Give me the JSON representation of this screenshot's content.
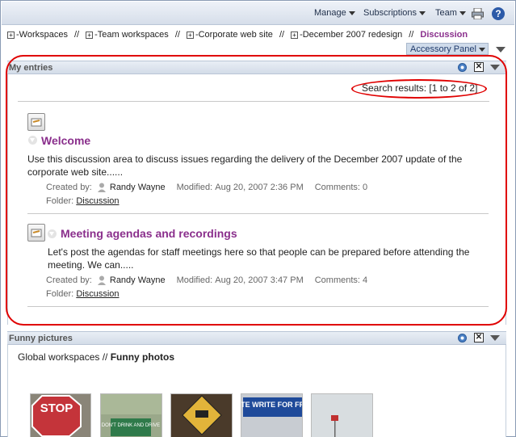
{
  "menus": [
    {
      "label": "Manage"
    },
    {
      "label": "Subscriptions"
    },
    {
      "label": "Team"
    }
  ],
  "icons": {
    "printer": "printer-icon",
    "help": "help-icon",
    "gear": "gear-icon",
    "close": "close-icon",
    "collapse": "collapse-triangle-icon",
    "expand": "plus-box-icon",
    "entry": "discussion-entry-icon",
    "person": "person-icon"
  },
  "help_glyph": "?",
  "breadcrumb": {
    "items": [
      "-Workspaces",
      "-Team workspaces",
      "-Corporate web site",
      "-December 2007 redesign"
    ],
    "separator": "//",
    "current": "Discussion",
    "plus": "+"
  },
  "accessory_panel": {
    "label": "Accessory Panel"
  },
  "my_entries": {
    "title": "My entries",
    "search_results": "Search results: [1 to 2 of 2]",
    "entries": [
      {
        "title": "Welcome",
        "description_lines": [
          "Use this discussion area to discuss issues regarding the delivery of the December 2007 update of the",
          "corporate web site......"
        ],
        "created_by_label": "Created by:",
        "author": "Randy Wayne",
        "modified_label": "Modified:",
        "modified": "Aug 20, 2007 2:36 PM",
        "comments_label": "Comments:",
        "comments": "0",
        "folder_label": "Folder:",
        "folder": "Discussion"
      },
      {
        "title": "Meeting agendas and recordings",
        "description_lines": [
          "Let's post the agendas for staff meetings here so that people can be prepared before attending the",
          "meeting. We can....."
        ],
        "created_by_label": "Created by:",
        "author": "Randy Wayne",
        "modified_label": "Modified:",
        "modified": "Aug 20, 2007 3:47 PM",
        "comments_label": "Comments:",
        "comments": "4",
        "folder_label": "Folder:",
        "folder": "Discussion"
      }
    ]
  },
  "funny_pictures": {
    "title": "Funny pictures",
    "path_prefix": "Global workspaces // ",
    "path_current": "Funny photos",
    "thumbnails": [
      {
        "name": "stop-sign-thumbnail",
        "text": "STOP"
      },
      {
        "name": "dont-drink-sign-thumbnail",
        "text": "DON'T DRINK AND DRIVE"
      },
      {
        "name": "road-sign-thumbnail",
        "text": ""
      },
      {
        "name": "illiterate-sign-thumbnail",
        "text": "ILLITERATE WRITE FOR FREE HELP"
      },
      {
        "name": "sky-sign-thumbnail",
        "text": ""
      }
    ]
  },
  "colors": {
    "accent_purple": "#8a2f8c",
    "annotation_red": "#e00000",
    "header_blue": "#d6deea"
  }
}
